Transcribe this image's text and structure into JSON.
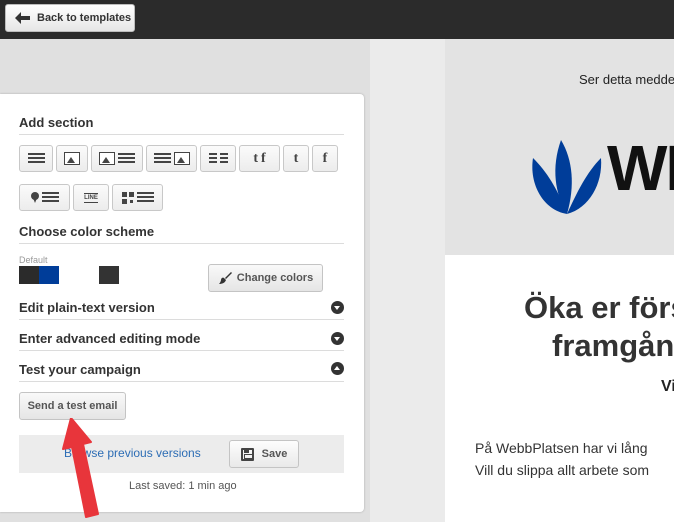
{
  "topbar": {
    "back_label": "Back to templates"
  },
  "sidebar": {
    "add_section_title": "Add section",
    "section_tools": [
      "text-block",
      "image-block",
      "image-text-block",
      "text-image-block",
      "two-column-text-block",
      "twitter-facebook-block",
      "twitter-block",
      "facebook-block",
      "map-text-block",
      "line-divider-block",
      "qr-text-block"
    ],
    "line_tool_text": "LINE",
    "color_scheme_title": "Choose color scheme",
    "default_label": "Default",
    "schemes": [
      {
        "name": "Default",
        "colors": [
          "#2b2b2b",
          "#003d99"
        ]
      },
      {
        "name": "",
        "colors": [
          "#333333"
        ]
      }
    ],
    "change_colors_label": "Change colors",
    "plain_text_title": "Edit plain-text version",
    "advanced_title": "Enter advanced editing mode",
    "test_title": "Test your campaign",
    "send_test_label": "Send a test email",
    "browse_versions_label": "Browse previous versions",
    "save_label": "Save",
    "last_saved": "Last saved: 1 min ago"
  },
  "preview": {
    "preheader": "Ser detta meddelande",
    "logo_text": "WEBB",
    "headline_line1": "Öka er förs",
    "headline_line2": "framgån",
    "subheading": "Vi",
    "body_line1": "På WebbPlatsen har vi lång",
    "body_line2": "Vill du slippa allt arbete som"
  },
  "colors": {
    "topbar": "#2b2b2b",
    "link": "#2d6db5",
    "logo_blue": "#003d99",
    "annotation_arrow": "#e8353b"
  }
}
